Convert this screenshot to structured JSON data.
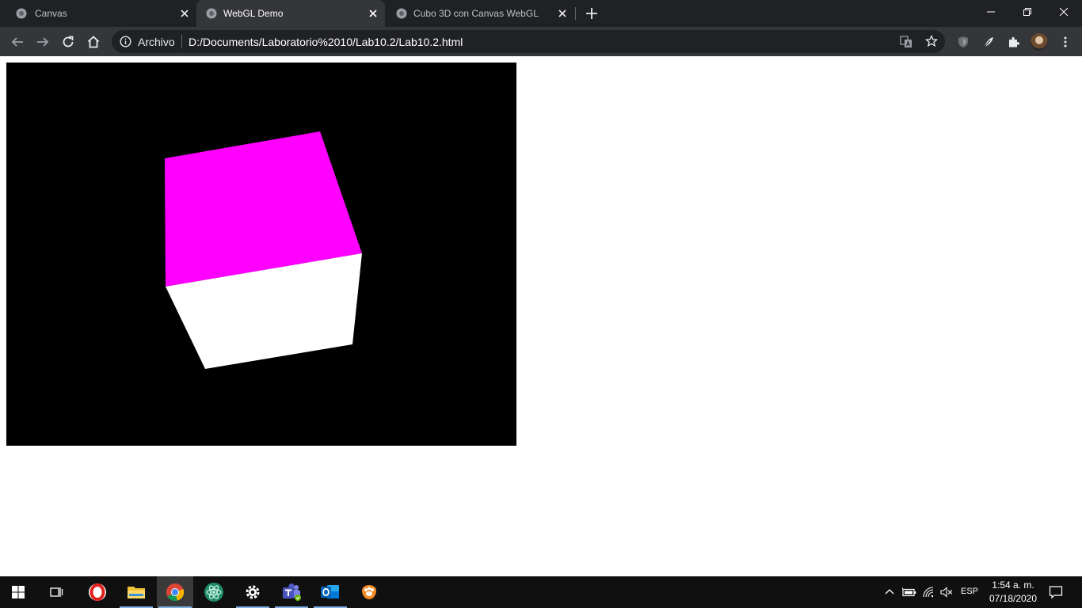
{
  "tabs": [
    {
      "title": "Canvas",
      "active": false
    },
    {
      "title": "WebGL Demo",
      "active": true
    },
    {
      "title": "Cubo 3D con Canvas WebGL",
      "active": false
    }
  ],
  "omnibox": {
    "security_label": "Archivo",
    "url": "D:/Documents/Laboratorio%2010/Lab10.2/Lab10.2.html"
  },
  "scene": {
    "background": "#000000",
    "cube_top_color": "#ff00ff",
    "cube_front_color": "#ffffff"
  },
  "taskbar": {
    "apps": [
      "windows-start",
      "task-view",
      "opera",
      "file-explorer",
      "chrome",
      "atom",
      "settings",
      "teams",
      "outlook",
      "orange-app"
    ],
    "language": "ESP",
    "time": "1:54 a. m.",
    "date": "07/18/2020"
  },
  "colors": {
    "tab_strip": "#202124",
    "toolbar": "#35363a",
    "taskbar": "#101010"
  }
}
